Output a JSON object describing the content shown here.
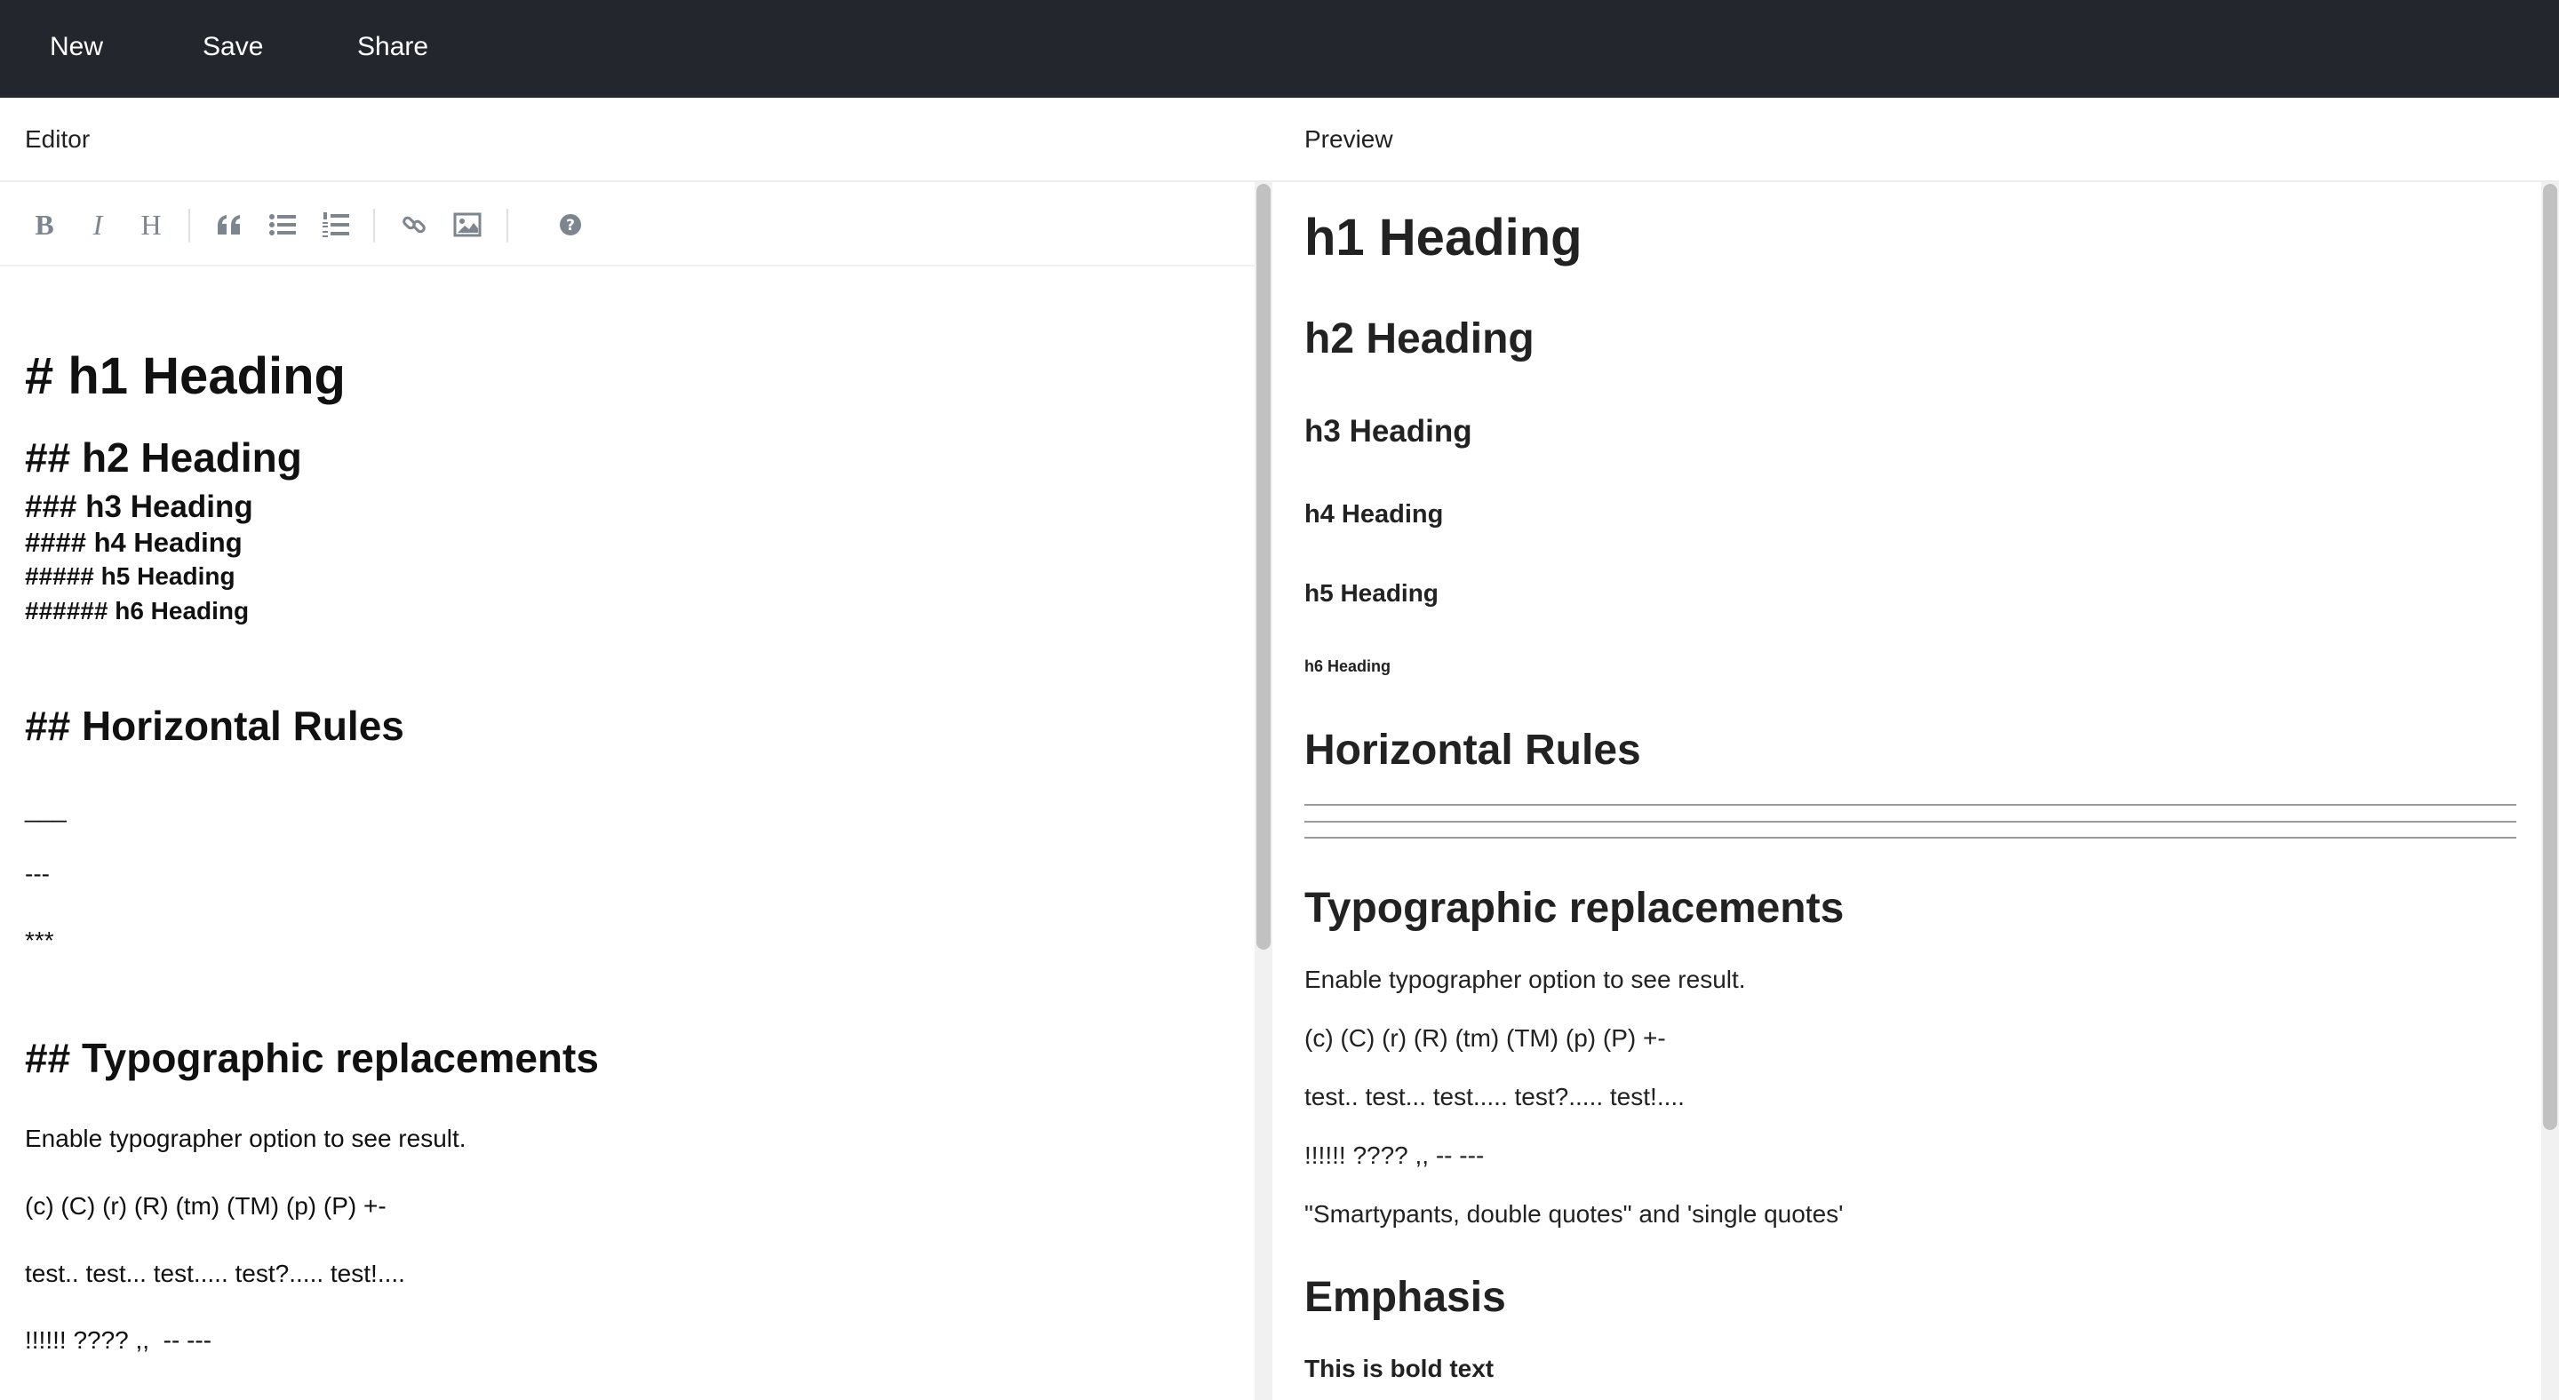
{
  "nav": {
    "new_label": "New",
    "save_label": "Save",
    "share_label": "Share"
  },
  "editor": {
    "header": "Editor",
    "toolbar": {
      "bold_icon": "B",
      "italic_icon": "I",
      "heading_icon": "H",
      "icons": [
        "bold-icon",
        "italic-icon",
        "heading-icon",
        "quote-icon",
        "unordered-list-icon",
        "ordered-list-icon",
        "link-icon",
        "image-icon",
        "help-icon"
      ]
    },
    "lines": {
      "h1": "# h1 Heading",
      "h2": "## h2 Heading",
      "h3": "### h3 Heading",
      "h4": "#### h4 Heading",
      "h5": "##### h5 Heading",
      "h6": "###### h6 Heading",
      "hr_title": "## Horizontal Rules",
      "hr1": "___",
      "hr2": "---",
      "hr3": "***",
      "typo_title": "## Typographic replacements",
      "typo_desc": "Enable typographer option to see result.",
      "typo_symbols": "(c) (C) (r) (R) (tm) (TM) (p) (P) +-",
      "typo_dots": "test.. test... test..... test?..... test!....",
      "typo_marks": "!!!!!! ???? ,,  -- ---"
    }
  },
  "preview": {
    "header": "Preview",
    "h1": "h1 Heading",
    "h2": "h2 Heading",
    "h3": "h3 Heading",
    "h4": "h4 Heading",
    "h5": "h5 Heading",
    "h6": "h6 Heading",
    "hr_title": "Horizontal Rules",
    "typo_title": "Typographic replacements",
    "typo_desc": "Enable typographer option to see result.",
    "typo_symbols": "(c) (C) (r) (R) (tm) (TM) (p) (P) +-",
    "typo_dots": "test.. test... test..... test?..... test!....",
    "typo_marks": "!!!!!! ???? ,, -- ---",
    "smarty": "\"Smartypants, double quotes\" and 'single quotes'",
    "emphasis_title": "Emphasis",
    "bold_text": "This is bold text"
  },
  "colors": {
    "topbar": "#23272d",
    "toolbar_icon": "#7d858e",
    "scroll_thumb": "#c1c1c1"
  }
}
